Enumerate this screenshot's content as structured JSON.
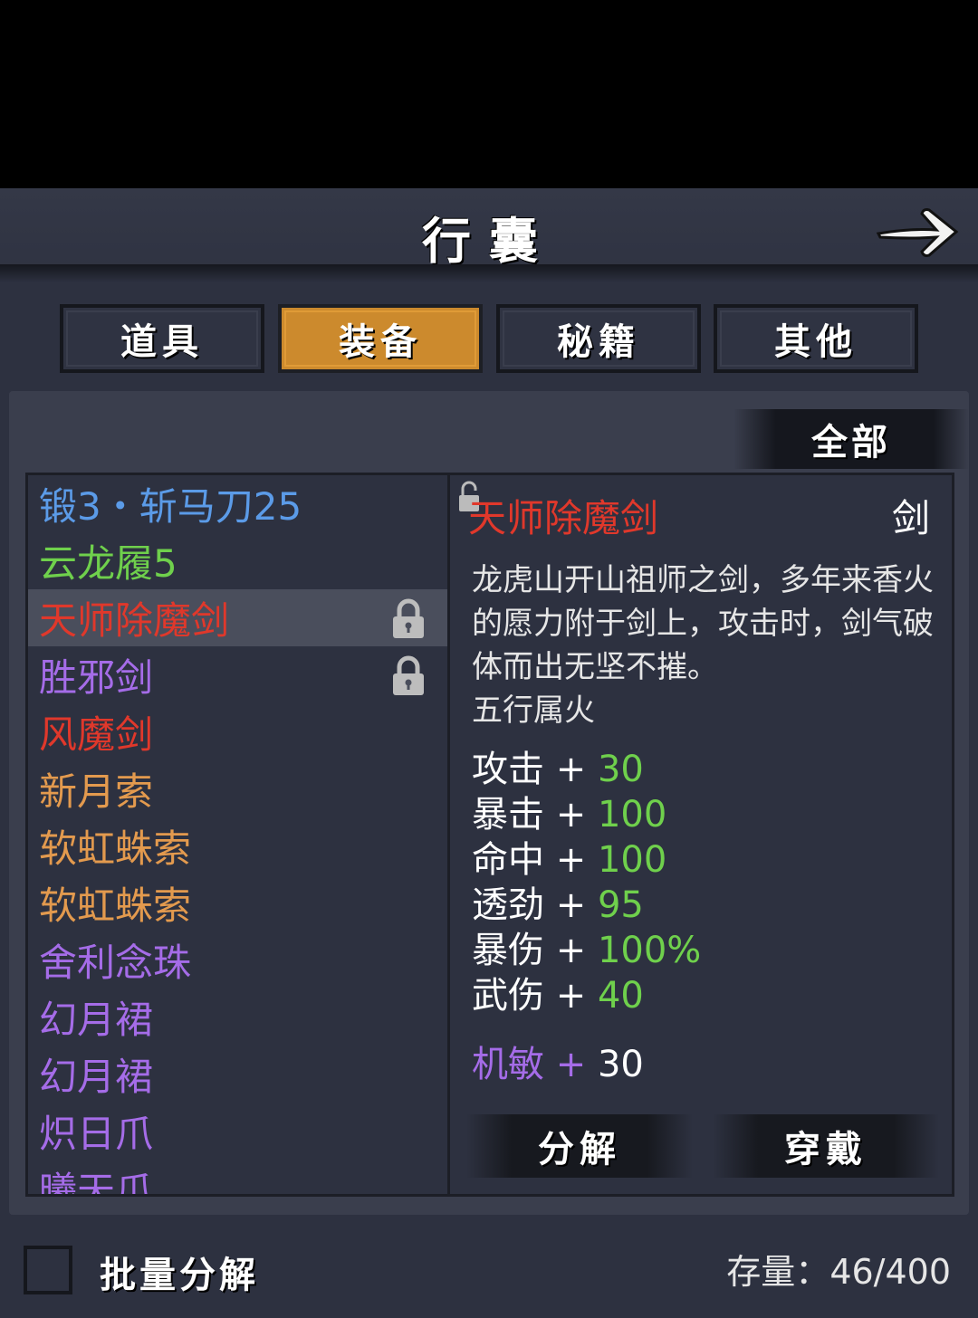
{
  "header": {
    "title": "行囊"
  },
  "tabs": [
    {
      "label": "道具",
      "active": false
    },
    {
      "label": "装备",
      "active": true
    },
    {
      "label": "秘籍",
      "active": false
    },
    {
      "label": "其他",
      "active": false
    }
  ],
  "filter": {
    "label": "全部"
  },
  "items": [
    {
      "name": "锻3・斩马刀25",
      "color": "#5b9be8",
      "locked": false,
      "selected": false
    },
    {
      "name": "云龙履5",
      "color": "#6fd04c",
      "locked": false,
      "selected": false
    },
    {
      "name": "天师除魔剑",
      "color": "#e0382b",
      "locked": true,
      "selected": true
    },
    {
      "name": "胜邪剑",
      "color": "#a56ce8",
      "locked": true,
      "selected": false
    },
    {
      "name": "风魔剑",
      "color": "#e0382b",
      "locked": false,
      "selected": false
    },
    {
      "name": "新月索",
      "color": "#e39a4e",
      "locked": false,
      "selected": false
    },
    {
      "name": "软虹蛛索",
      "color": "#e39a4e",
      "locked": false,
      "selected": false
    },
    {
      "name": "软虹蛛索",
      "color": "#e39a4e",
      "locked": false,
      "selected": false
    },
    {
      "name": "舍利念珠",
      "color": "#a56ce8",
      "locked": false,
      "selected": false
    },
    {
      "name": "幻月裙",
      "color": "#a56ce8",
      "locked": false,
      "selected": false
    },
    {
      "name": "幻月裙",
      "color": "#a56ce8",
      "locked": false,
      "selected": false
    },
    {
      "name": "炽日爪",
      "color": "#a56ce8",
      "locked": false,
      "selected": false
    },
    {
      "name": "曦天爪",
      "color": "#a56ce8",
      "locked": false,
      "selected": false
    }
  ],
  "detail": {
    "name": "天师除魔剑",
    "type": "剑",
    "description": "龙虎山开山祖师之剑，多年来香火的愿力附于剑上，攻击时，剑气破体而出无坚不摧。",
    "element": "五行属火",
    "stats": [
      {
        "key": "攻击",
        "sep": "+",
        "value": "30"
      },
      {
        "key": "暴击",
        "sep": "+",
        "value": "100"
      },
      {
        "key": "命中",
        "sep": "+",
        "value": "100"
      },
      {
        "key": "透劲",
        "sep": "+",
        "value": "95"
      },
      {
        "key": "暴伤",
        "sep": "+",
        "value": "100%"
      },
      {
        "key": "武伤",
        "sep": "+",
        "value": "40"
      }
    ],
    "extra_stat": {
      "key": "机敏",
      "sep": "+",
      "value": "30"
    },
    "decompose_label": "分解",
    "equip_label": "穿戴"
  },
  "bottom": {
    "batch_label": "批量分解",
    "storage_label": "存量",
    "storage_value": "46/400"
  }
}
